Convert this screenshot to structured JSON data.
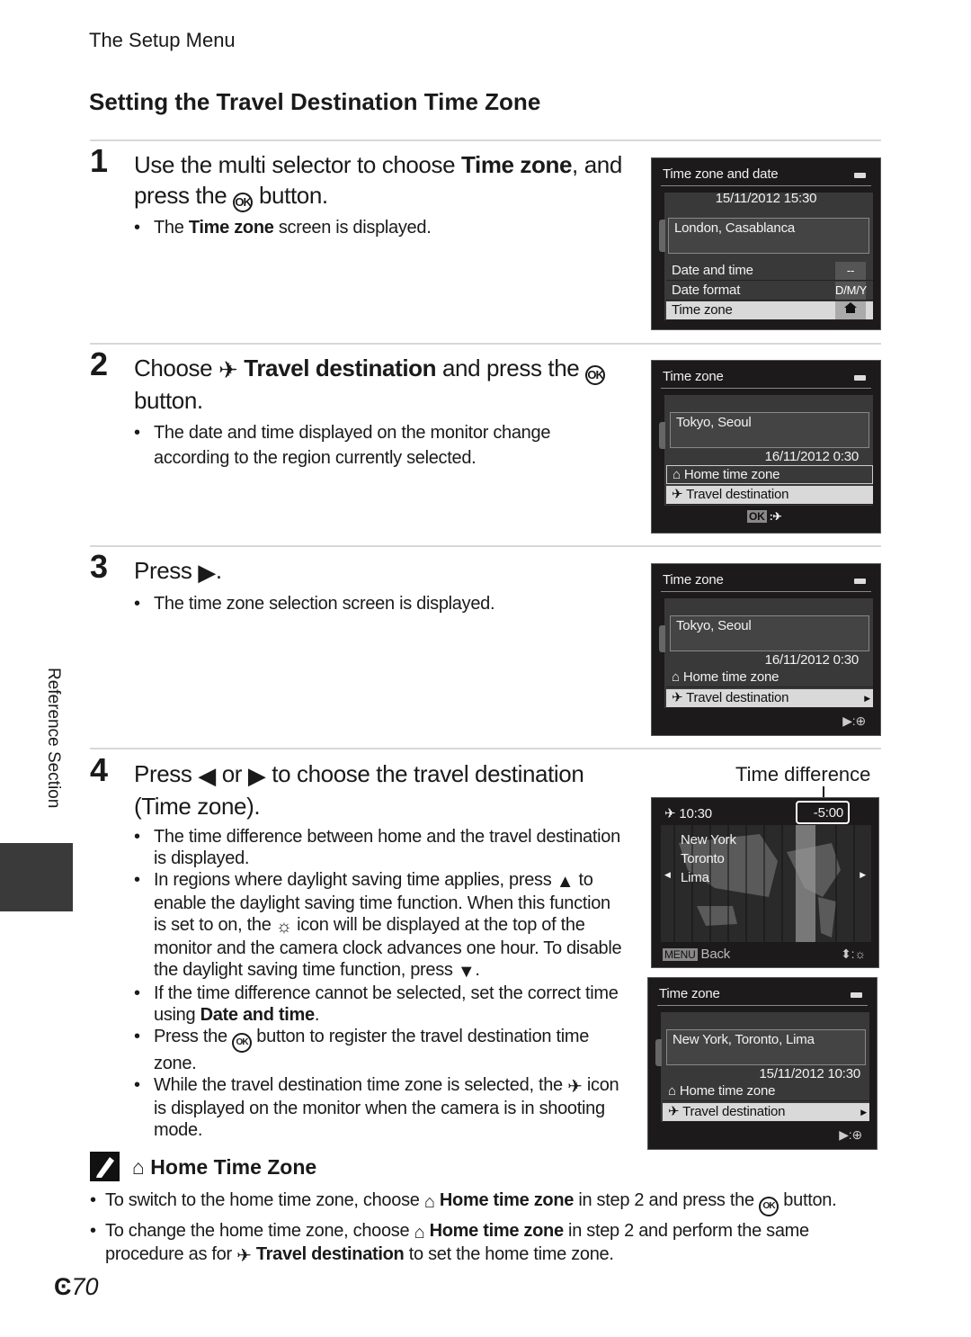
{
  "header": "The Setup Menu",
  "title": "Setting the Travel Destination Time Zone",
  "side_tab": "Reference Section",
  "steps": [
    {
      "num": "1",
      "head": [
        {
          "t": "Use the multi selector to choose "
        },
        {
          "t": "Time zone",
          "b": 1
        },
        {
          "t": ", and press the "
        },
        {
          "i": "ok"
        },
        {
          "t": " button."
        }
      ],
      "bullets": [
        [
          {
            "t": "The "
          },
          {
            "t": "Time zone",
            "b": 1
          },
          {
            "t": " screen is displayed."
          }
        ]
      ]
    },
    {
      "num": "2",
      "head": [
        {
          "t": "Choose "
        },
        {
          "i": "plane"
        },
        {
          "t": " "
        },
        {
          "t": "Travel destination",
          "b": 1
        },
        {
          "t": " and press the "
        },
        {
          "i": "ok"
        },
        {
          "t": " button."
        }
      ],
      "bullets": [
        [
          {
            "t": "The date and time displayed on the monitor change according to the region currently selected."
          }
        ]
      ]
    },
    {
      "num": "3",
      "head": [
        {
          "t": "Press "
        },
        {
          "i": "right"
        },
        {
          "t": "."
        }
      ],
      "bullets": [
        [
          {
            "t": "The time zone selection screen is displayed."
          }
        ]
      ]
    },
    {
      "num": "4",
      "head": [
        {
          "t": "Press "
        },
        {
          "i": "left"
        },
        {
          "t": " or "
        },
        {
          "i": "right"
        },
        {
          "t": " to choose the travel destination (Time zone)."
        }
      ],
      "bullets": [
        [
          {
            "t": "The time difference between home and the travel destination is displayed."
          }
        ],
        [
          {
            "t": "In regions where daylight saving time applies, press "
          },
          {
            "i": "up"
          },
          {
            "t": " to enable the daylight saving time function. When this function is set to on, the "
          },
          {
            "i": "dst"
          },
          {
            "t": " icon will be displayed at the top of the monitor and the camera clock advances one hour. To disable the daylight saving time function, press "
          },
          {
            "i": "down"
          },
          {
            "t": "."
          }
        ],
        [
          {
            "t": "If the time difference cannot be selected, set the correct time using "
          },
          {
            "t": "Date and time",
            "b": 1
          },
          {
            "t": "."
          }
        ],
        [
          {
            "t": "Press the "
          },
          {
            "i": "ok"
          },
          {
            "t": " button to register the travel destination time zone."
          }
        ],
        [
          {
            "t": "While the travel destination time zone is selected, the "
          },
          {
            "i": "plane"
          },
          {
            "t": " icon is displayed on the monitor when the camera is in shooting mode."
          }
        ]
      ]
    }
  ],
  "screens": {
    "s1": {
      "title": "Time zone and date",
      "datetime": "15/11/2012  15:30",
      "city": "London, Casablanca",
      "rows": [
        {
          "label": "Date and time",
          "value": "--"
        },
        {
          "label": "Date format",
          "value": "D/M/Y"
        },
        {
          "label": "Time zone",
          "value": "home-icon"
        }
      ]
    },
    "s2": {
      "title": "Time zone",
      "city": "Tokyo, Seoul",
      "datetime": "16/11/2012  0:30",
      "home": "Home time zone",
      "travel": "Travel destination",
      "hint": "OK"
    },
    "s3": {
      "title": "Time zone",
      "city": "Tokyo, Seoul",
      "datetime": "16/11/2012  0:30",
      "home": "Home time zone",
      "travel": "Travel destination"
    },
    "s4": {
      "callout": "Time difference",
      "time": "10:30",
      "diff": "-5:00",
      "cities": [
        "New York",
        "Toronto",
        "Lima"
      ],
      "menu": "MENU",
      "back": "Back"
    },
    "s5": {
      "title": "Time zone",
      "city": "New York, Toronto, Lima",
      "datetime": "15/11/2012  10:30",
      "home": "Home time zone",
      "travel": "Travel destination"
    }
  },
  "note": {
    "title": "Home Time Zone",
    "items": [
      [
        {
          "t": "To switch to the home time zone, choose "
        },
        {
          "i": "home"
        },
        {
          "t": " "
        },
        {
          "t": "Home time zone",
          "b": 1
        },
        {
          "t": " in step 2 and press the "
        },
        {
          "i": "ok"
        },
        {
          "t": " button."
        }
      ],
      [
        {
          "t": "To change the home time zone, choose "
        },
        {
          "i": "home"
        },
        {
          "t": " "
        },
        {
          "t": "Home time zone",
          "b": 1
        },
        {
          "t": " in step 2 and perform the same procedure as for "
        },
        {
          "i": "plane"
        },
        {
          "t": " "
        },
        {
          "t": "Travel destination",
          "b": 1
        },
        {
          "t": " to set the home time zone."
        }
      ]
    ]
  },
  "page_number": "70",
  "colors": {
    "screen_bg": "#1c1a1b",
    "selected_row": "#d9d9d9",
    "side_block": "#3a3a3a"
  }
}
